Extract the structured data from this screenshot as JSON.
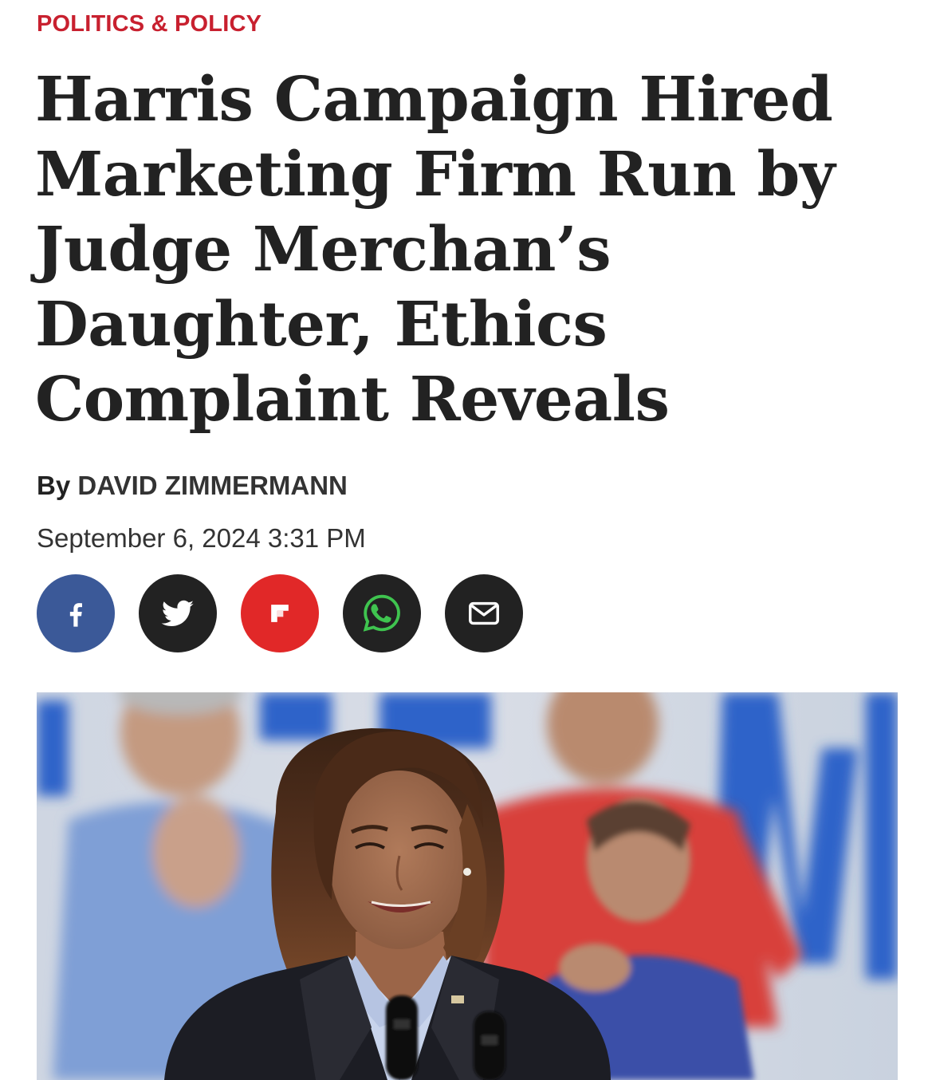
{
  "article": {
    "category": "POLITICS & POLICY",
    "headline": "Harris Campaign Hired Marketing Firm Run by Judge Merchan’s Daughter, Ethics Complaint Reveals",
    "byline_prefix": "By",
    "author": "DAVID ZIMMERMANN",
    "date": "September 6, 2024 3:31 PM"
  },
  "share": [
    {
      "name": "facebook",
      "icon": "facebook-icon",
      "color": "#3b5998"
    },
    {
      "name": "twitter",
      "icon": "twitter-icon",
      "color": "#222222"
    },
    {
      "name": "flipboard",
      "icon": "flipboard-icon",
      "color": "#e12828"
    },
    {
      "name": "whatsapp",
      "icon": "whatsapp-icon",
      "color": "#222222"
    },
    {
      "name": "email",
      "icon": "email-icon",
      "color": "#222222"
    }
  ],
  "colors": {
    "category_red": "#c8202f",
    "headline": "#222222"
  }
}
